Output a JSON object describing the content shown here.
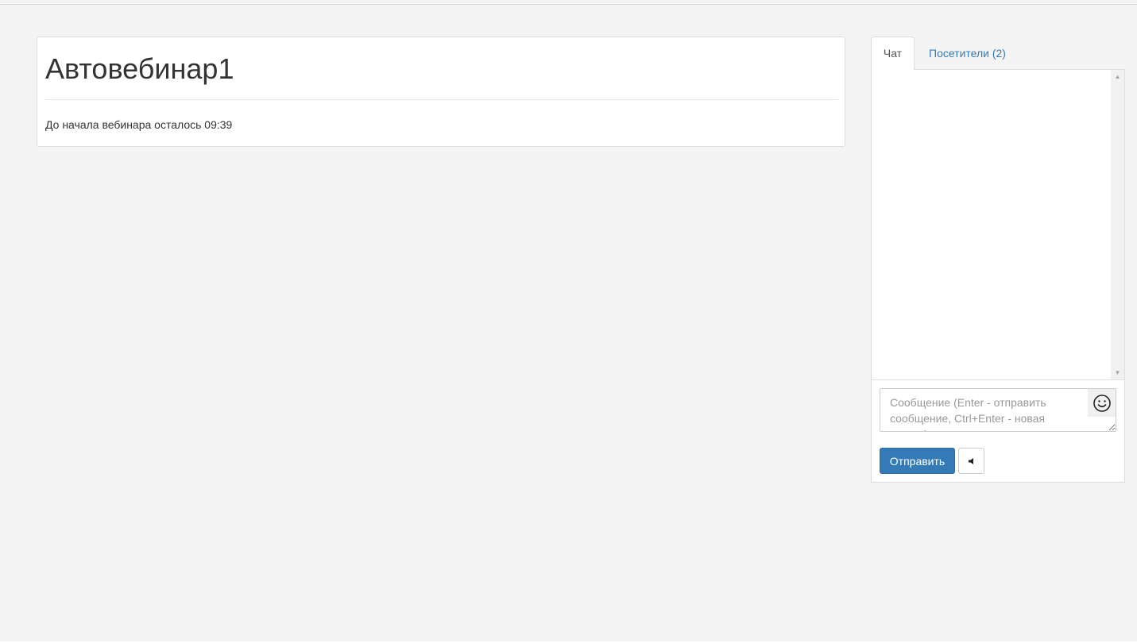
{
  "webinar": {
    "title": "Автовебинар1",
    "countdown_text": "До начала вебинара осталось 09:39"
  },
  "tabs": [
    {
      "label": "Чат",
      "active": true
    },
    {
      "label": "Посетители (2)",
      "active": false
    }
  ],
  "chat": {
    "message_placeholder": "Сообщение (Enter - отправить сообщение, Ctrl+Enter - новая строка)",
    "message_value": "",
    "send_label": "Отправить",
    "emoji_icon": "smiley-face-icon",
    "sound_icon": "speaker-icon"
  },
  "colors": {
    "accent": "#337ab7",
    "background": "#f4f4f4"
  }
}
